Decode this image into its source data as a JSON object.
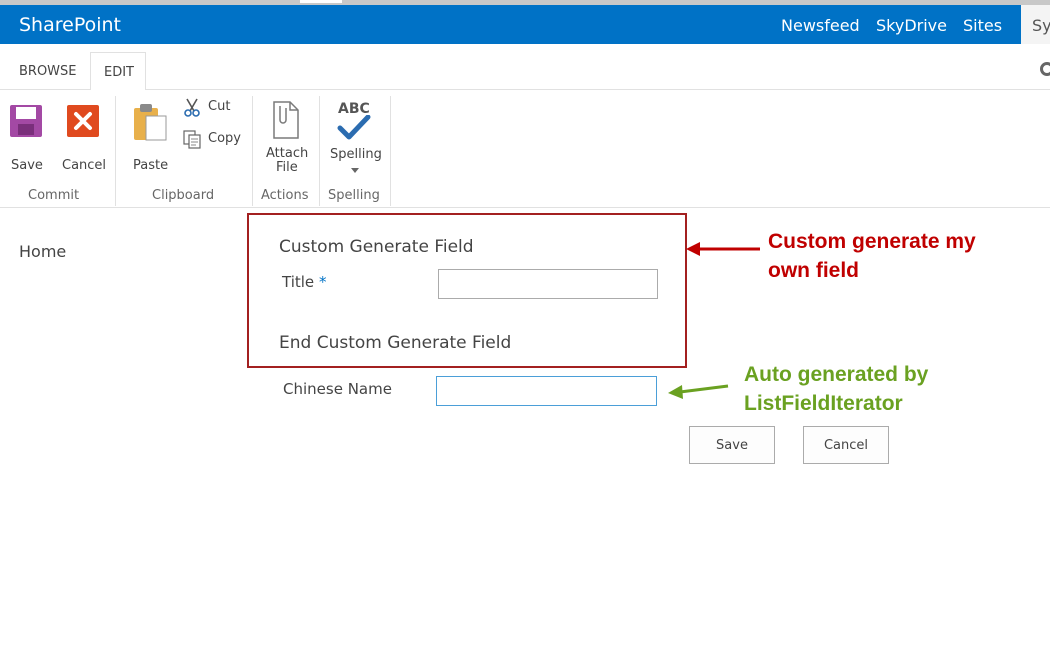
{
  "suite": {
    "brand": "SharePoint",
    "links": [
      "Newsfeed",
      "SkyDrive",
      "Sites"
    ],
    "user_initials": "Sy",
    "colors": {
      "bar": "#0072c6"
    }
  },
  "ribbon": {
    "tabs": {
      "browse": "BROWSE",
      "edit": "EDIT"
    },
    "commit": {
      "save": "Save",
      "cancel": "Cancel",
      "group": "Commit"
    },
    "clipboard": {
      "paste": "Paste",
      "cut": "Cut",
      "copy": "Copy",
      "group": "Clipboard"
    },
    "actions": {
      "attach_line1": "Attach",
      "attach_line2": "File",
      "group": "Actions"
    },
    "spelling": {
      "abc": "ABC",
      "label": "Spelling",
      "group": "Spelling"
    }
  },
  "nav": {
    "home": "Home"
  },
  "form": {
    "custom_start": "Custom Generate Field",
    "title_label": "Title",
    "required_mark": "*",
    "title_value": "",
    "custom_end": "End Custom Generate Field",
    "chinese_name_label": "Chinese Name",
    "chinese_name_value": "",
    "save_button": "Save",
    "cancel_button": "Cancel"
  },
  "annotations": {
    "custom_line1": "Custom generate my",
    "custom_line2": "own field",
    "auto_line1": "Auto generated by",
    "auto_line2": "ListFieldIterator",
    "colors": {
      "custom": "#c00000",
      "auto": "#6aa121"
    }
  }
}
